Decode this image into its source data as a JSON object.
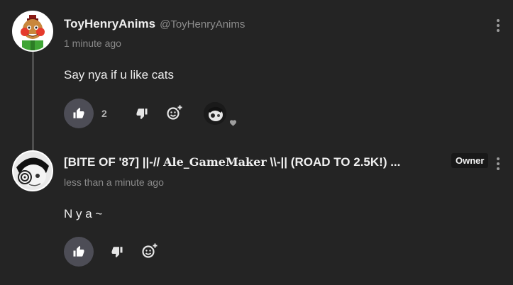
{
  "comments": [
    {
      "author": "ToyHenryAnims",
      "handle": "@ToyHenryAnims",
      "time": "1 minute ago",
      "text": "Say nya if u like cats",
      "like_count": "2",
      "creator_hearted": true
    },
    {
      "author_prefix": "[BITE OF '87] ||-// ",
      "author_fancy": "Ale_GameMaker",
      "author_suffix": " \\\\-|| (ROAD TO 2.5K!) ...",
      "badge": "Owner",
      "time": "less than a minute ago",
      "text": "N y a ~"
    }
  ],
  "icons": {
    "like": "thumbs-up-icon",
    "dislike": "thumbs-down-icon",
    "react": "add-reaction-icon",
    "more": "kebab-menu-icon",
    "heart": "heart-icon"
  },
  "colors": {
    "background": "#242424",
    "like_button": "#4d4d56",
    "muted_text": "#8a8a8a"
  }
}
